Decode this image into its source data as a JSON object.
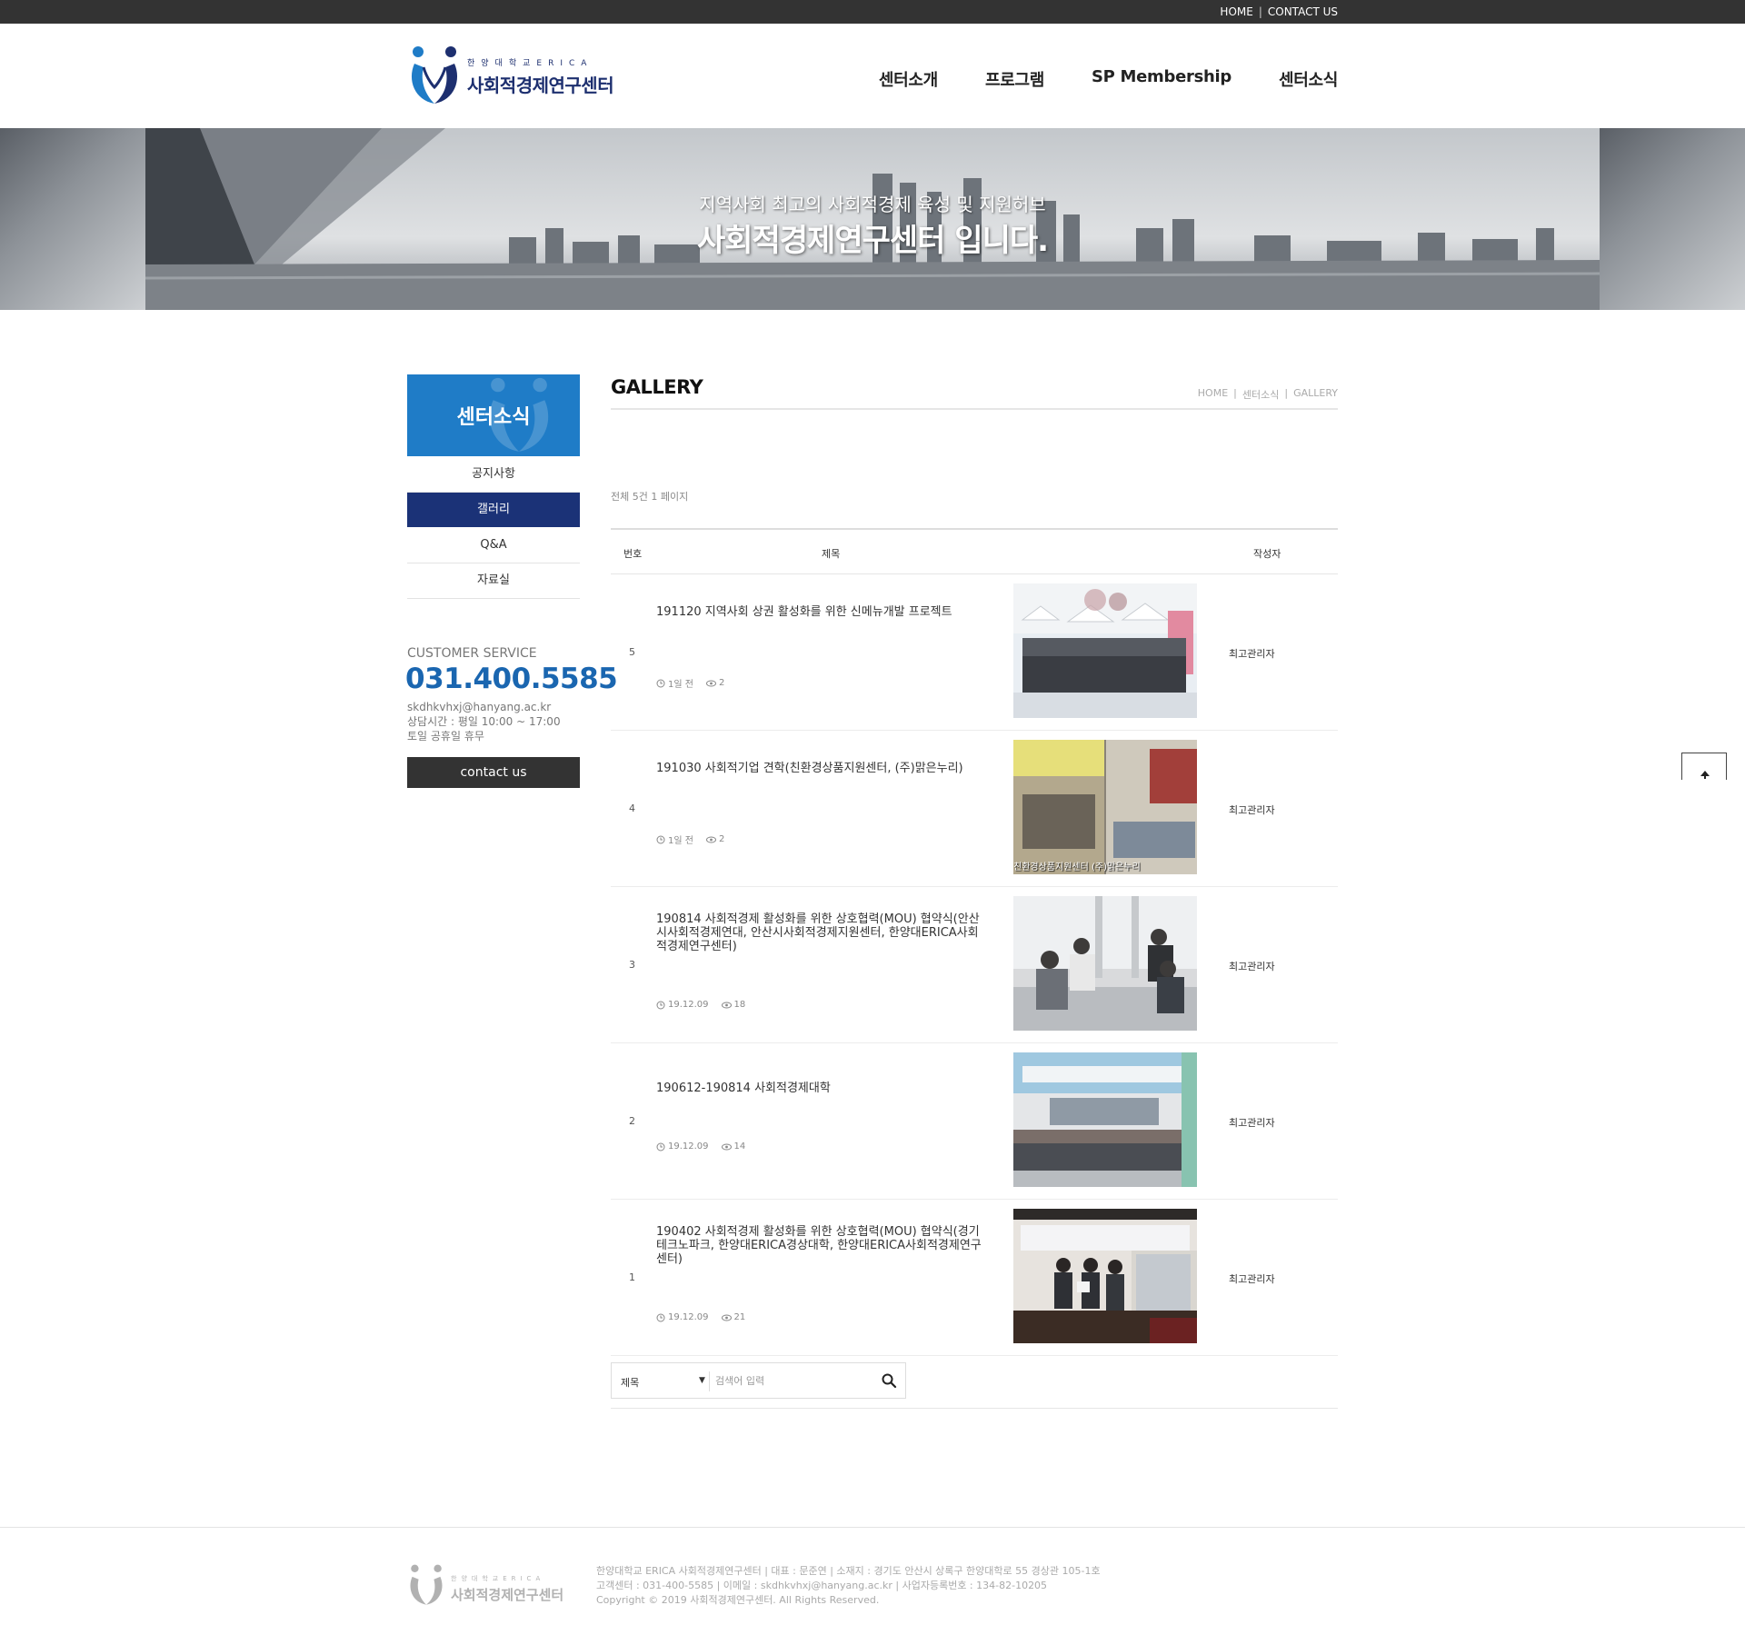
{
  "top_util": {
    "home": "HOME",
    "separator": "|",
    "contact": "CONTACT US"
  },
  "logo": {
    "sub": "한양대학교ERICA",
    "main": "사회적경제연구센터"
  },
  "gnb": [
    "센터소개",
    "프로그램",
    "SP Membership",
    "센터소식"
  ],
  "hero": {
    "line1": "지역사회 최고의 사회적경제 육성 및 지원허브",
    "line2": "사회적경제연구센터 입니다."
  },
  "sidebar": {
    "title": "센터소식",
    "items": [
      {
        "label": "공지사항",
        "active": false
      },
      {
        "label": "갤러리",
        "active": true
      },
      {
        "label": "Q&A",
        "active": false
      },
      {
        "label": "자료실",
        "active": false
      }
    ],
    "cs_title": "CUSTOMER SERVICE",
    "cs_phone": "031.400.5585",
    "cs_email": "skdhkvhxj@hanyang.ac.kr",
    "cs_hours": "상담시간 : 평일 10:00 ~ 17:00",
    "cs_holiday": "토일 공휴일 휴무",
    "contact_button": "contact us"
  },
  "content": {
    "title": "GALLERY",
    "breadcrumb": [
      "HOME",
      "센터소식",
      "GALLERY"
    ],
    "breadcrumb_sep": "|",
    "count_text": "전체 5건 1 페이지",
    "columns": {
      "num": "번호",
      "subject": "제목",
      "writer": "작성자"
    },
    "rows": [
      {
        "num": "5",
        "subject": "191120 지역사회 상권 활성화를 위한 신메뉴개발 프로젝트",
        "date": "1일 전",
        "views": "2",
        "writer": "최고관리자"
      },
      {
        "num": "4",
        "subject": "191030 사회적기업 견학(친환경상품지원센터, (주)맑은누리)",
        "date": "1일 전",
        "views": "2",
        "writer": "최고관리자",
        "caption": "친환경상품지원센터 (주)맑은누리"
      },
      {
        "num": "3",
        "subject": "190814 사회적경제 활성화를 위한 상호협력(MOU) 협약식(안산시사회적경제연대, 안산시사회적경제지원센터, 한양대ERICA사회적경제연구센터)",
        "date": "19.12.09",
        "views": "18",
        "writer": "최고관리자"
      },
      {
        "num": "2",
        "subject": "190612-190814 사회적경제대학",
        "date": "19.12.09",
        "views": "14",
        "writer": "최고관리자"
      },
      {
        "num": "1",
        "subject": "190402 사회적경제 활성화를 위한 상호협력(MOU) 협약식(경기테크노파크, 한양대ERICA경상대학, 한양대ERICA사회적경제연구센터)",
        "date": "19.12.09",
        "views": "21",
        "writer": "최고관리자"
      }
    ],
    "search": {
      "select_value": "제목",
      "placeholder": "검색어 입력"
    }
  },
  "footer": {
    "logo_sub": "한양대학교ERICA",
    "logo_main": "사회적경제연구센터",
    "line1": "한양대학교 ERICA 사회적경제연구센터   |   대표 : 문준연   |   소재지 : 경기도 안산시 상록구 한양대학로 55 경상관 105-1호",
    "line2": "고객센터 : 031-400-5585   |   이메일 : skdhkvhxj@hanyang.ac.kr   |   사업자등록번호 : 134-82-10205",
    "line3": "Copyright © 2019 사회적경제연구센터. All Rights Reserved."
  },
  "colors": {
    "brand_blue": "#1f7cc7",
    "navy": "#1b3277",
    "phone_blue": "#1a66b0",
    "topbar": "#333333"
  },
  "icons": [
    "logo-mark-icon",
    "clock-icon",
    "eye-icon",
    "search-icon",
    "arrow-up-icon",
    "caret-down-icon"
  ]
}
